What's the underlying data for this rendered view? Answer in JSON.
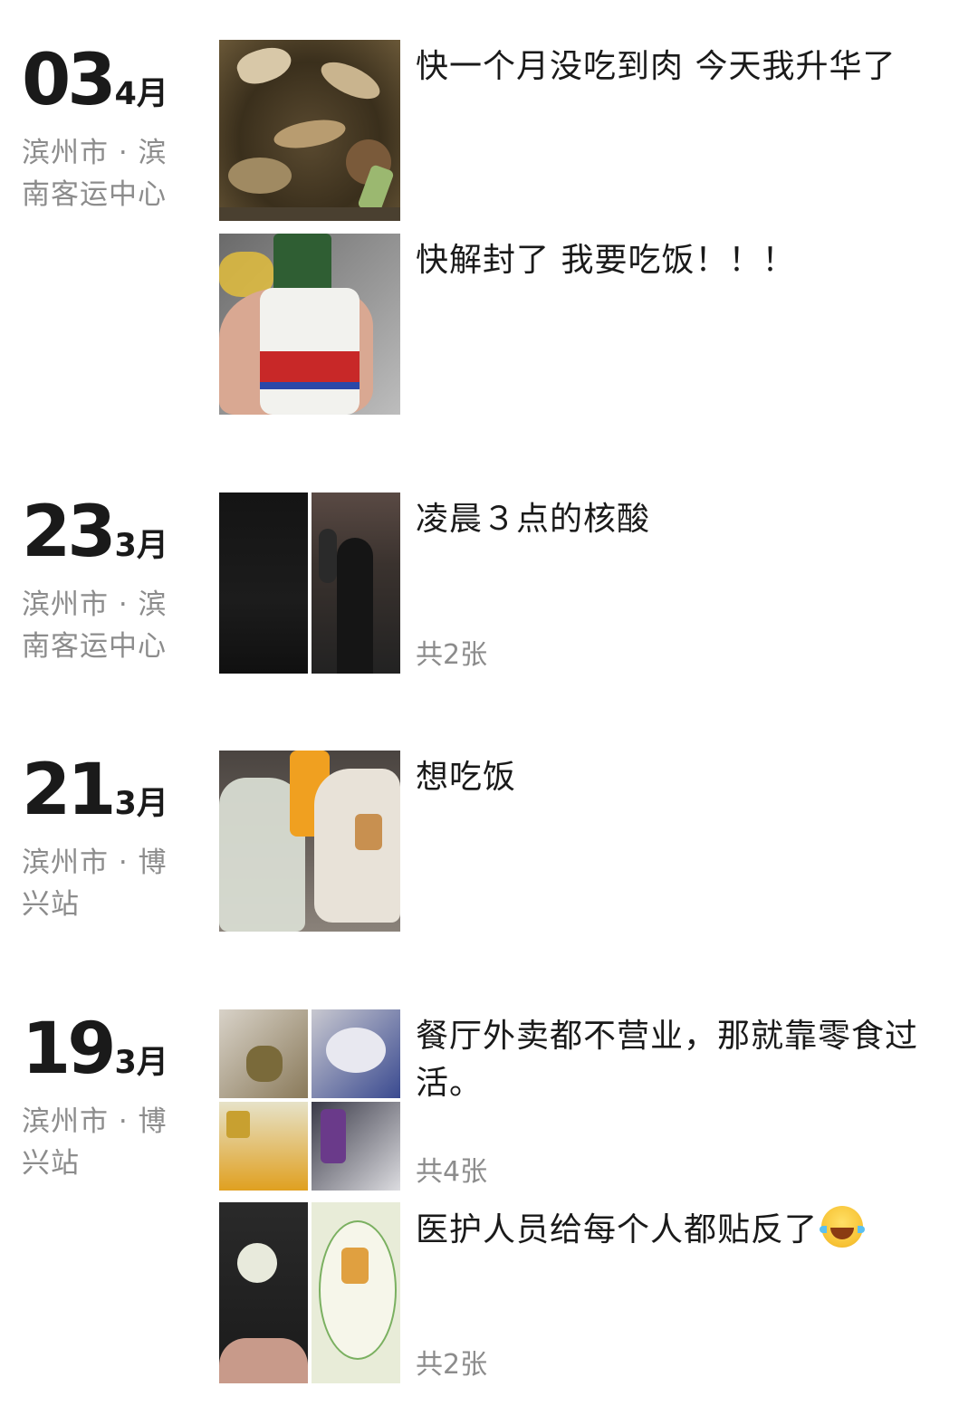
{
  "groups": [
    {
      "day": "03",
      "month": "4月",
      "location": "滨州市 · 滨南客运中心",
      "posts": [
        {
          "text": "快一个月没吃到肉 今天我升华了",
          "image_count": "",
          "thumb": "food-bowl"
        },
        {
          "text": "快解封了 我要吃饭！！！",
          "image_count": "",
          "thumb": "soda-bottle"
        }
      ]
    },
    {
      "day": "23",
      "month": "3月",
      "location": "滨州市 · 滨南客运中心",
      "posts": [
        {
          "text": "凌晨３点的核酸",
          "image_count": "共2张",
          "thumb": "night-photos"
        }
      ]
    },
    {
      "day": "21",
      "month": "3月",
      "location": "滨州市 · 博兴站",
      "posts": [
        {
          "text": "想吃饭",
          "image_count": "",
          "thumb": "food-bags"
        }
      ]
    },
    {
      "day": "19",
      "month": "3月",
      "location": "滨州市 · 博兴站",
      "posts": [
        {
          "text": "餐厅外卖都不营业，那就靠零食过活。",
          "image_count": "共4张",
          "thumb": "snacks-grid"
        },
        {
          "text": "医护人员给每个人都贴反了",
          "image_count": "共2张",
          "thumb": "stickers",
          "emoji": "tears-of-joy-emoji"
        }
      ]
    }
  ],
  "colors": {
    "text": "#1a1a1a",
    "secondary": "#8c8c8c",
    "background": "#ffffff"
  }
}
